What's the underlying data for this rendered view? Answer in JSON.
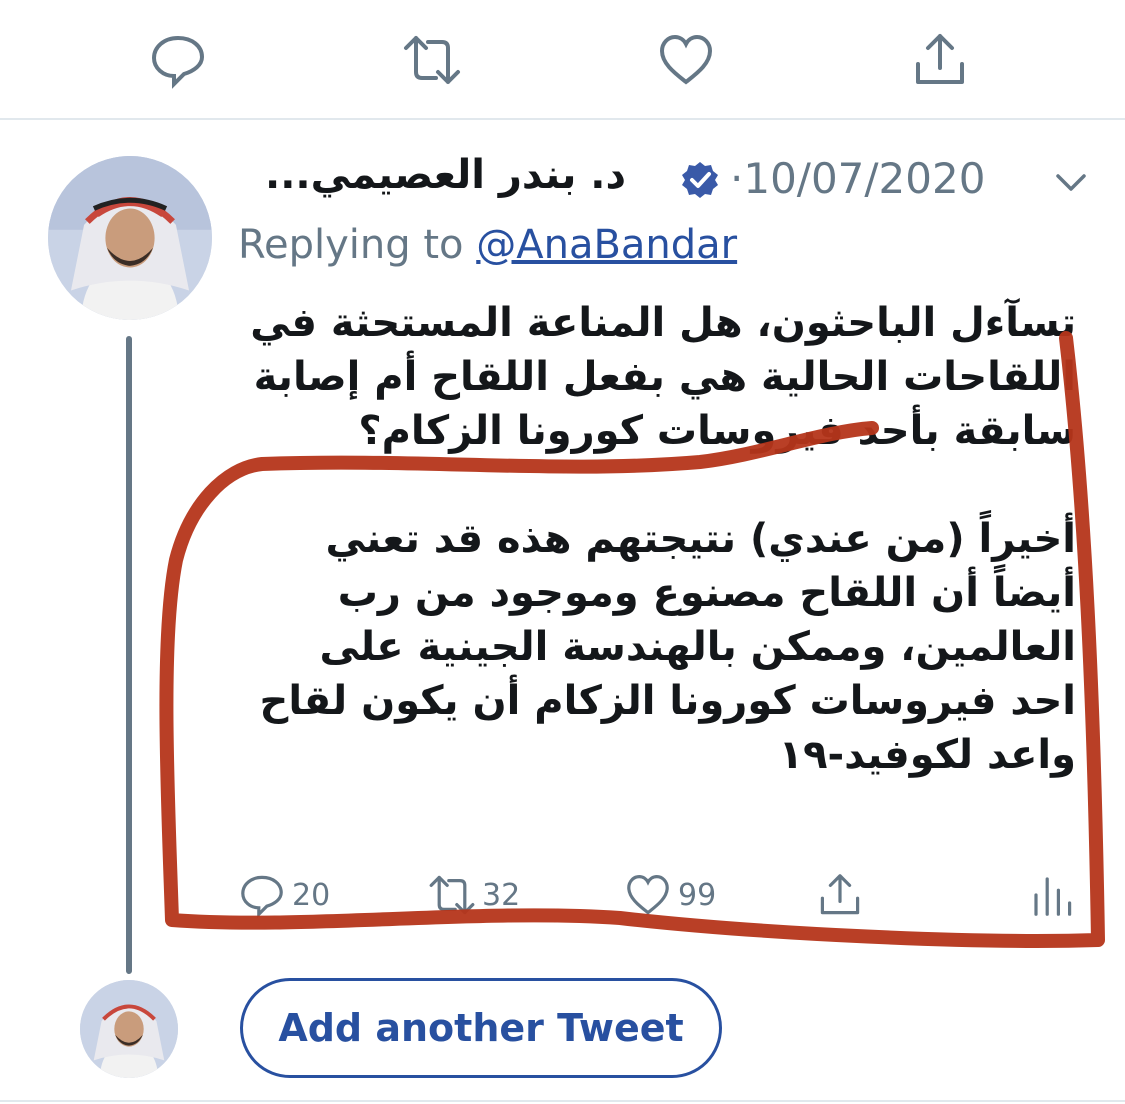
{
  "top_actions": {
    "icons": [
      "reply-icon",
      "retweet-icon",
      "like-icon",
      "share-icon"
    ]
  },
  "tweet": {
    "author_name": "د. بندر العصيمي...",
    "separator": "·",
    "date": "10/07/2020",
    "replying_prefix": "Replying to ",
    "replying_handle": "@AnaBandar",
    "body_para1": "تسآءل الباحثون، هل المناعة المستحثة في اللقاحات الحالية هي بفعل اللقاح أم إصابة سابقة بأحد فيروسات كورونا الزكام؟",
    "body_para2": "أخيراً (من عندي) نتيجتهم هذه قد تعني أيضاً أن اللقاح مصنوع وموجود من رب العالمين، وممكن بالهندسة الجينية على احد فيروسات كورونا الزكام أن يكون لقاح واعد لكوفيد-١٩",
    "stats": {
      "replies": "20",
      "retweets": "32",
      "likes": "99"
    }
  },
  "add_tweet_label": "Add another Tweet",
  "colors": {
    "accent": "#2850a0",
    "secondary_text": "#657786",
    "verified": "#3a5aa8",
    "annotation": "#b5351a"
  }
}
